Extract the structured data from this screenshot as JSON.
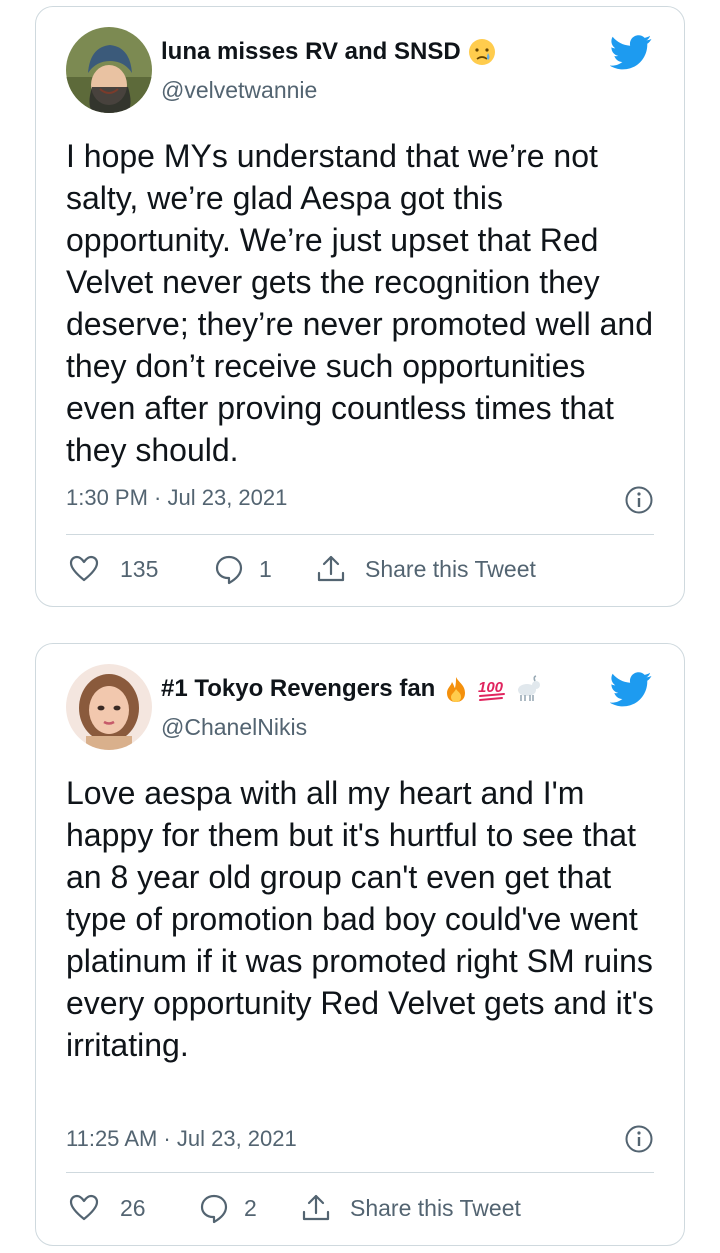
{
  "tweets": [
    {
      "display_name": "luna misses RV and SNSD",
      "name_emoji": [
        "crying-face-icon"
      ],
      "handle": "@velvetwannie",
      "text": "I hope MYs understand that we’re not salty, we’re glad Aespa got this opportunity. We’re just upset that Red Velvet never gets the recognition they deserve; they’re never promoted well and they don’t receive such opportunities even after proving countless times that they should.",
      "timestamp": "1:30 PM · Jul 23, 2021",
      "likes": "135",
      "replies": "1",
      "share_label": "Share this Tweet"
    },
    {
      "display_name": "#1 Tokyo Revengers fan",
      "name_emoji": [
        "fire-icon",
        "hundred-points-icon",
        "goat-icon"
      ],
      "handle": "@ChanelNikis",
      "text": "Love aespa with all my heart and I'm happy for them but it's hurtful to see that an 8 year old group can't even get that type of promotion bad boy could've went platinum if it was promoted right SM ruins every opportunity Red Velvet gets and it's irritating.",
      "timestamp": "11:25 AM · Jul 23, 2021",
      "likes": "26",
      "replies": "2",
      "share_label": "Share this Tweet"
    }
  ],
  "icons": {
    "brand": "twitter-bird-icon",
    "like": "heart-icon",
    "reply": "reply-bubble-icon",
    "share": "share-upload-icon",
    "info": "info-icon"
  },
  "colors": {
    "twitter_blue": "#1d9bf0",
    "text_primary": "#0f1419",
    "text_secondary": "#536471",
    "border": "#cfd9de"
  }
}
